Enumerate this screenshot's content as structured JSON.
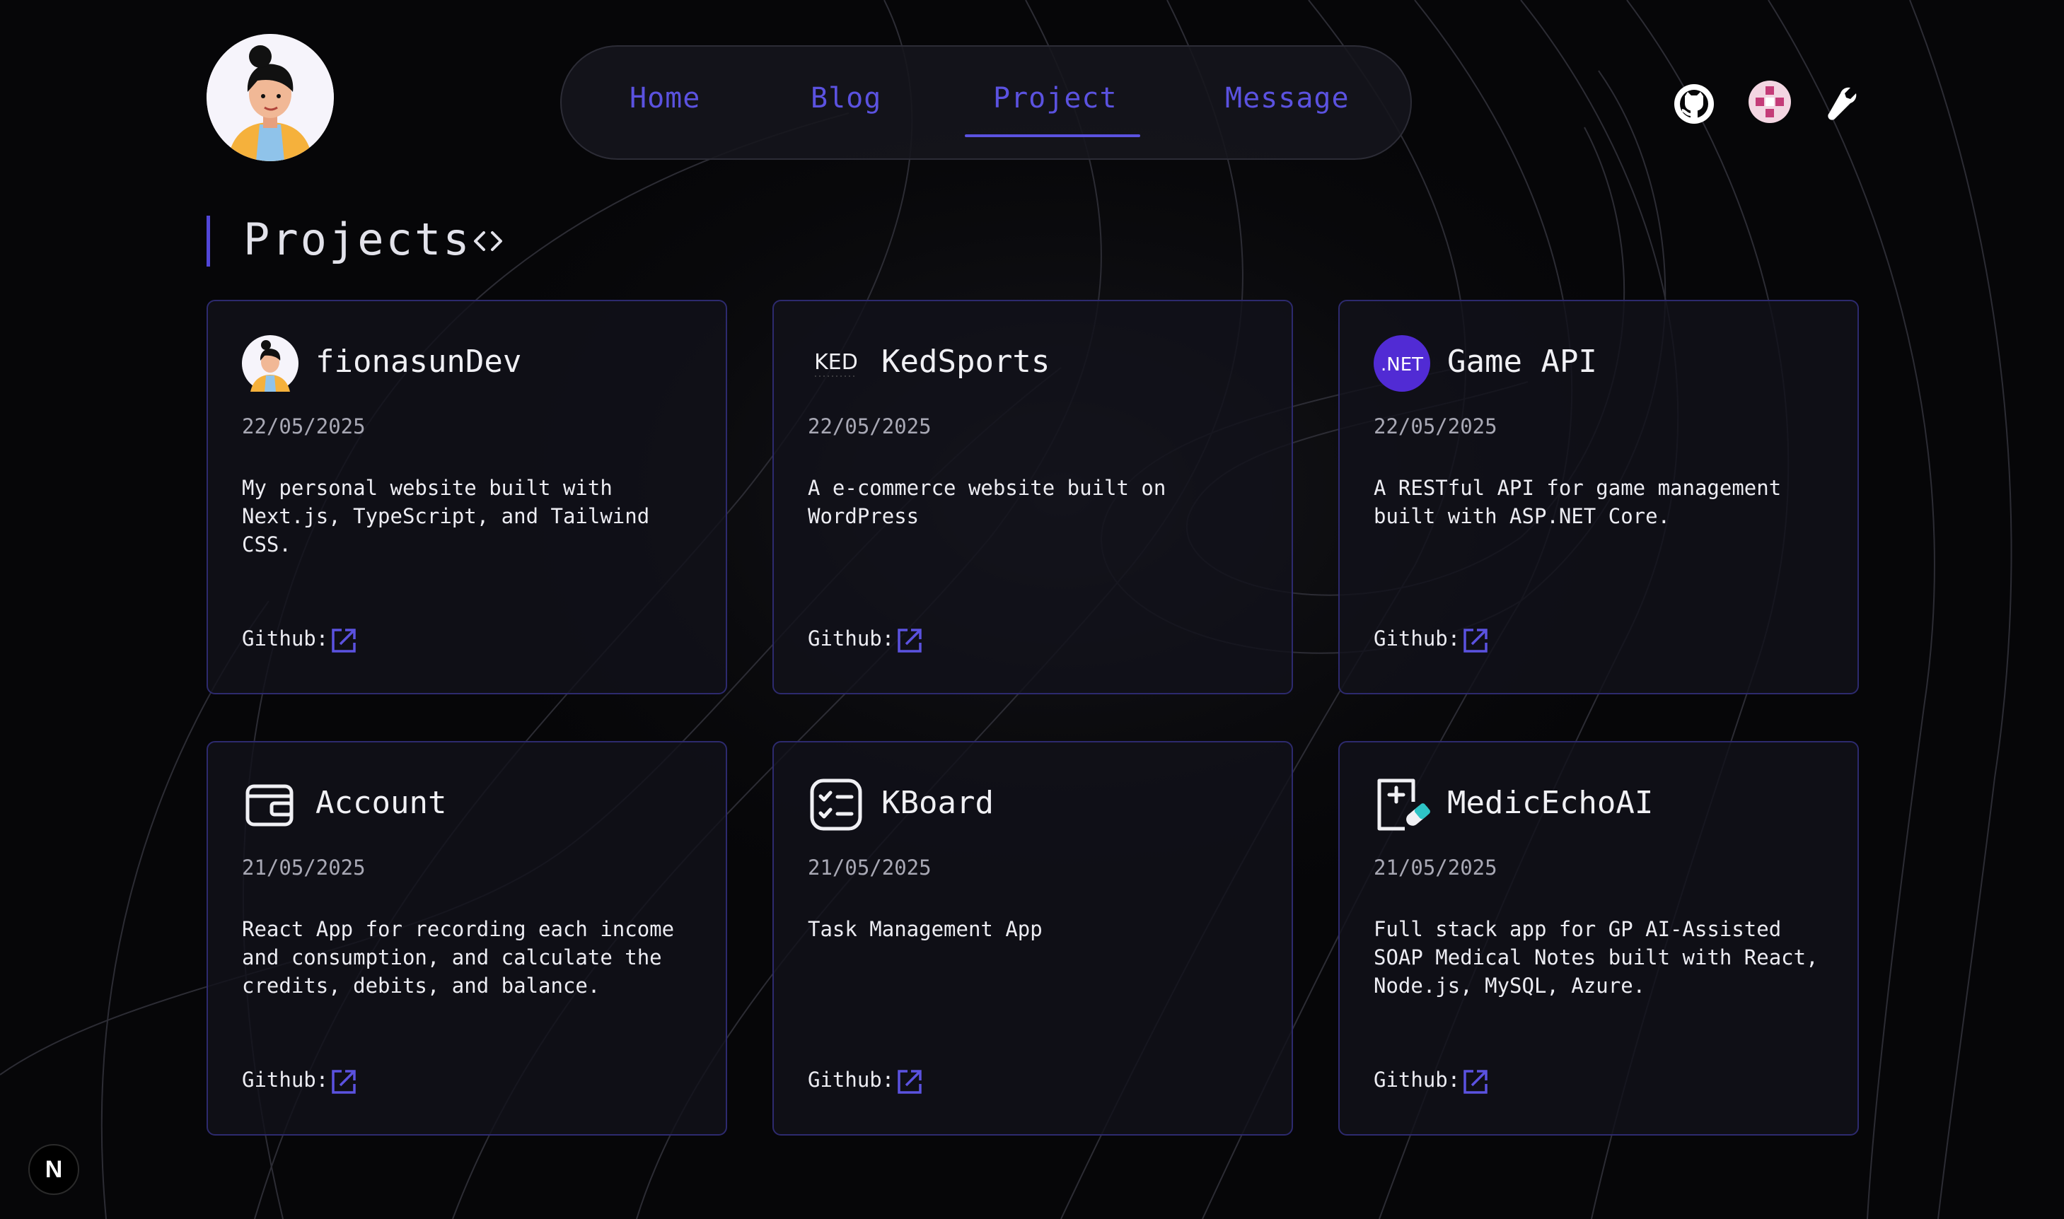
{
  "nav": {
    "items": [
      {
        "label": "Home"
      },
      {
        "label": "Blog"
      },
      {
        "label": "Project",
        "active": true
      },
      {
        "label": "Message"
      }
    ]
  },
  "header_icons": [
    "github-icon",
    "pink-pixel-avatar-icon",
    "wrench-icon"
  ],
  "page": {
    "title": "Projects",
    "title_icon": "code-brackets-icon"
  },
  "projects": [
    {
      "name": "fionasunDev",
      "date": "22/05/2025",
      "description": "My personal website built with Next.js, TypeScript, and Tailwind CSS.",
      "github_label": "Github:",
      "icon": "avatar-icon"
    },
    {
      "name": "KedSports",
      "date": "22/05/2025",
      "description": "A e-commerce website built on WordPress",
      "github_label": "Github:",
      "icon": "kedsports-logo-icon",
      "icon_text": "KED"
    },
    {
      "name": "Game API",
      "date": "22/05/2025",
      "description": "A RESTful API for game management built with ASP.NET Core.",
      "github_label": "Github:",
      "icon": "dotnet-logo-icon",
      "icon_text": ".NET"
    },
    {
      "name": "Account",
      "date": "21/05/2025",
      "description": "React App for recording each income and consumption, and calculate the credits, debits, and balance.",
      "github_label": "Github:",
      "icon": "wallet-icon"
    },
    {
      "name": "KBoard",
      "date": "21/05/2025",
      "description": "Task Management App",
      "github_label": "Github:",
      "icon": "checklist-icon"
    },
    {
      "name": "MedicEchoAI",
      "date": "21/05/2025",
      "description": "Full stack app for GP AI-Assisted SOAP Medical Notes built with React, Node.js, MySQL, Azure.",
      "github_label": "Github:",
      "icon": "medical-report-icon"
    }
  ],
  "framework_badge": "N",
  "colors": {
    "accent": "#5b52e0",
    "background": "#060608",
    "card_border": "#2d2a6e",
    "dotnet_purple": "#512bd4"
  }
}
